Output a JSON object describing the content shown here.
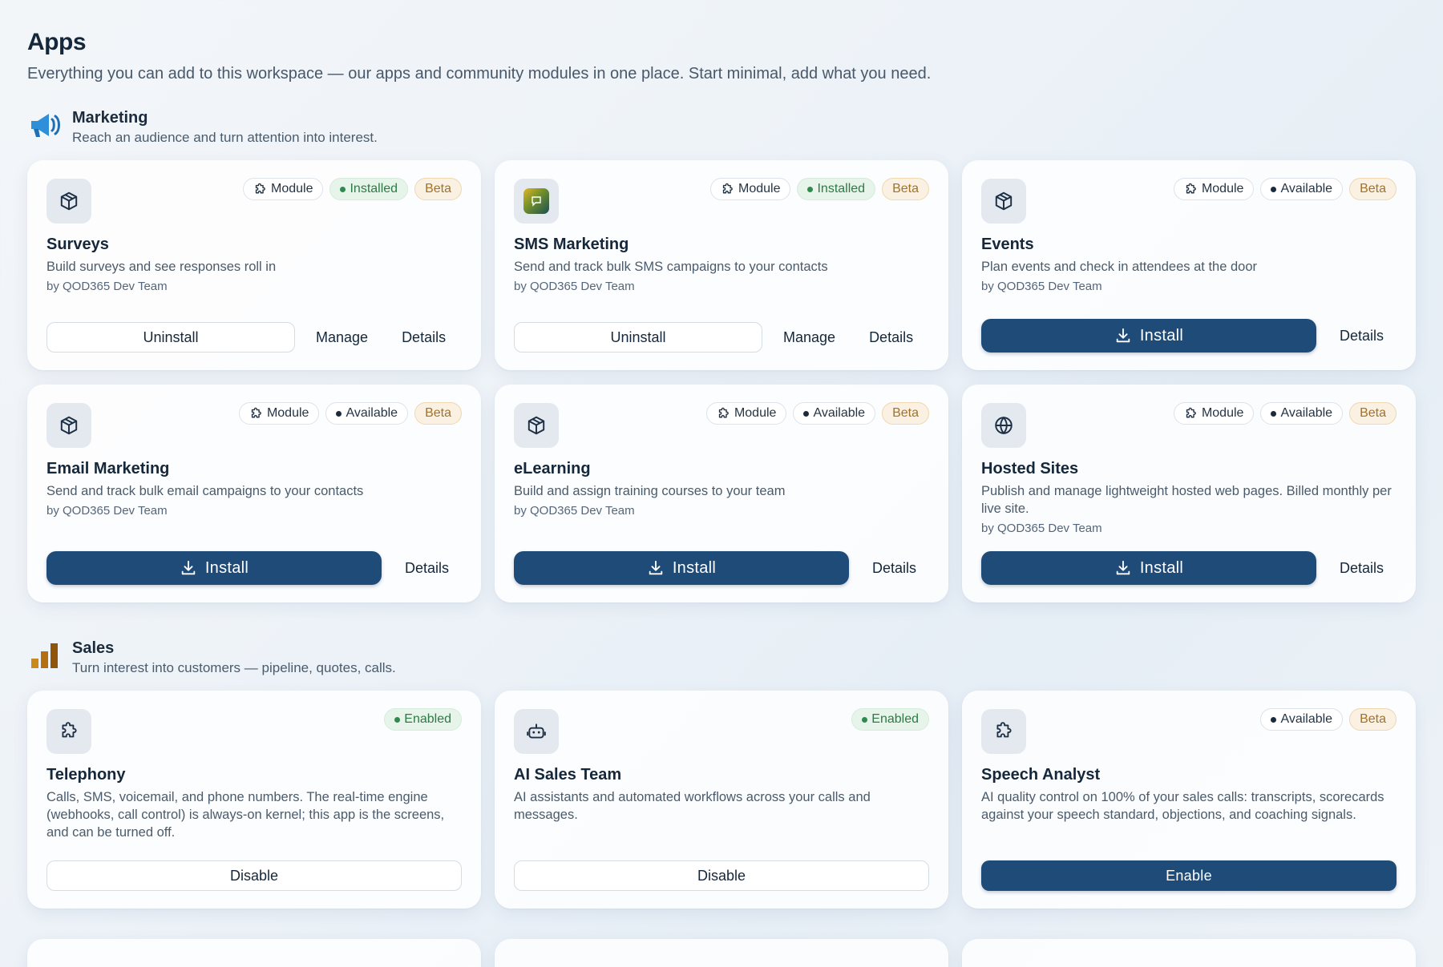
{
  "page": {
    "title": "Apps",
    "subtitle": "Everything you can add to this workspace — our apps and community modules in one place. Start minimal, add what you need."
  },
  "sections": [
    {
      "name": "Marketing",
      "description": "Reach an audience and turn attention into interest.",
      "icon": "megaphone-icon",
      "apps": [
        {
          "name": "Surveys",
          "description": "Build surveys and see responses roll in",
          "author": "by QOD365 Dev Team",
          "badges": [
            "Module",
            "Installed",
            "Beta"
          ],
          "actions": [
            "Uninstall",
            "Manage",
            "Details"
          ]
        },
        {
          "name": "SMS Marketing",
          "description": "Send and track bulk SMS campaigns to your contacts",
          "author": "by QOD365 Dev Team",
          "badges": [
            "Module",
            "Installed",
            "Beta"
          ],
          "actions": [
            "Uninstall",
            "Manage",
            "Details"
          ]
        },
        {
          "name": "Events",
          "description": "Plan events and check in attendees at the door",
          "author": "by QOD365 Dev Team",
          "badges": [
            "Module",
            "Available",
            "Beta"
          ],
          "actions": [
            "Install",
            "Details"
          ]
        },
        {
          "name": "Email Marketing",
          "description": "Send and track bulk email campaigns to your contacts",
          "author": "by QOD365 Dev Team",
          "badges": [
            "Module",
            "Available",
            "Beta"
          ],
          "actions": [
            "Install",
            "Details"
          ]
        },
        {
          "name": "eLearning",
          "description": "Build and assign training courses to your team",
          "author": "by QOD365 Dev Team",
          "badges": [
            "Module",
            "Available",
            "Beta"
          ],
          "actions": [
            "Install",
            "Details"
          ]
        },
        {
          "name": "Hosted Sites",
          "description": "Publish and manage lightweight hosted web pages. Billed monthly per live site.",
          "author": "by QOD365 Dev Team",
          "badges": [
            "Module",
            "Available",
            "Beta"
          ],
          "actions": [
            "Install",
            "Details"
          ]
        }
      ]
    },
    {
      "name": "Sales",
      "description": "Turn interest into customers — pipeline, quotes, calls.",
      "icon": "bar-chart-icon",
      "apps": [
        {
          "name": "Telephony",
          "description": "Calls, SMS, voicemail, and phone numbers. The real-time engine (webhooks, call control) is always-on kernel; this app is the screens, and can be turned off.",
          "badges": [
            "Enabled"
          ],
          "actions": [
            "Disable"
          ]
        },
        {
          "name": "AI Sales Team",
          "description": "AI assistants and automated workflows across your calls and messages.",
          "badges": [
            "Enabled"
          ],
          "actions": [
            "Disable"
          ]
        },
        {
          "name": "Speech Analyst",
          "description": "AI quality control on 100% of your sales calls: transcripts, scorecards against your speech standard, objections, and coaching signals.",
          "badges": [
            "Available",
            "Beta"
          ],
          "actions": [
            "Enable"
          ]
        }
      ]
    }
  ],
  "colors": {
    "primary": "#1f4b78",
    "installed_bg": "#e6f4ea",
    "installed_text": "#2e7a47",
    "beta_bg": "#fbf1e2",
    "beta_text": "#a0722c"
  }
}
